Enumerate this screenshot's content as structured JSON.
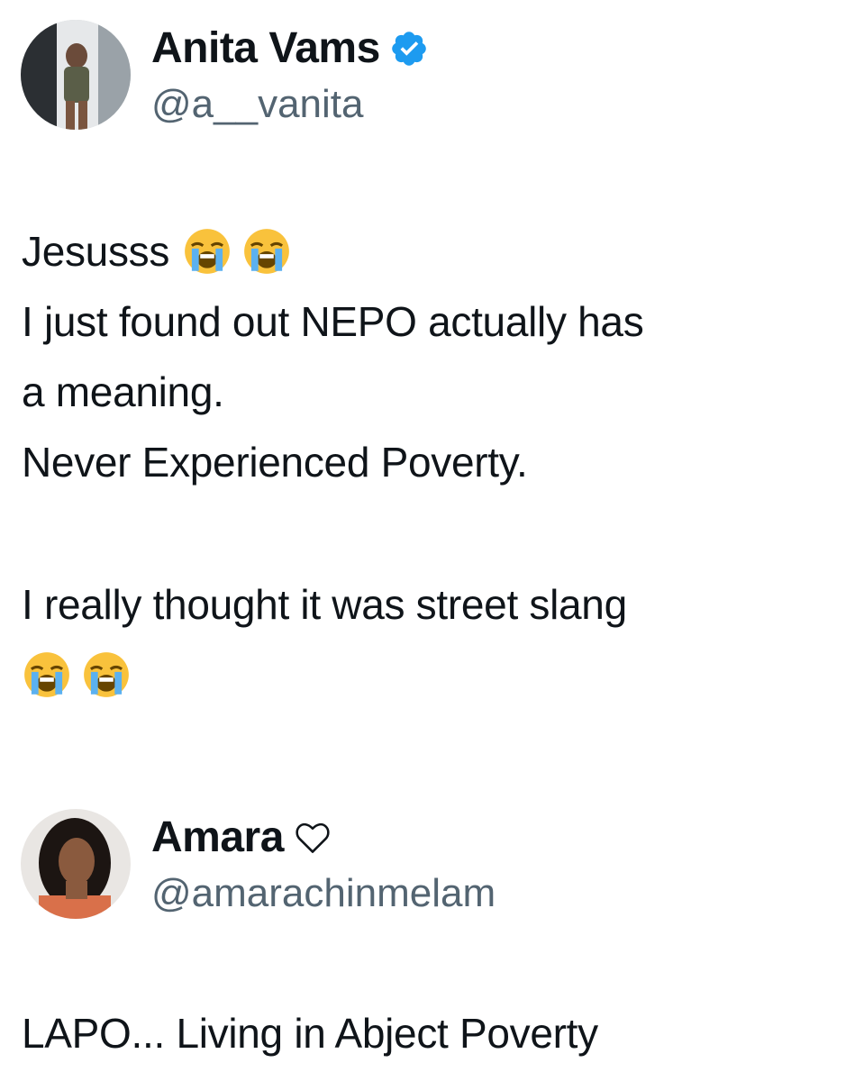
{
  "posts": [
    {
      "author": {
        "display_name": "Anita Vams",
        "handle": "@a__vanita",
        "verified": true,
        "badge_color": "#1d9bf0"
      },
      "text_lines": {
        "l1": "Jesusss",
        "l2": "I just found out NEPO actually has",
        "l3": "a meaning.",
        "l4": "Never Experienced Poverty.",
        "l5": "I really thought it was street slang"
      },
      "emoji_icon": "loudly-crying-face-icon"
    },
    {
      "author": {
        "display_name": "Amara",
        "handle": "@amarachinmelam",
        "name_suffix_icon": "white-heart-icon"
      },
      "text_lines": {
        "l1": "LAPO... Living in Abject Poverty"
      }
    }
  ],
  "colors": {
    "text": "#0f1419",
    "secondary_text": "#536471",
    "verified_blue": "#1d9bf0",
    "emoji_yellow": "#f9c23c",
    "emoji_tear": "#5bb1f0"
  }
}
